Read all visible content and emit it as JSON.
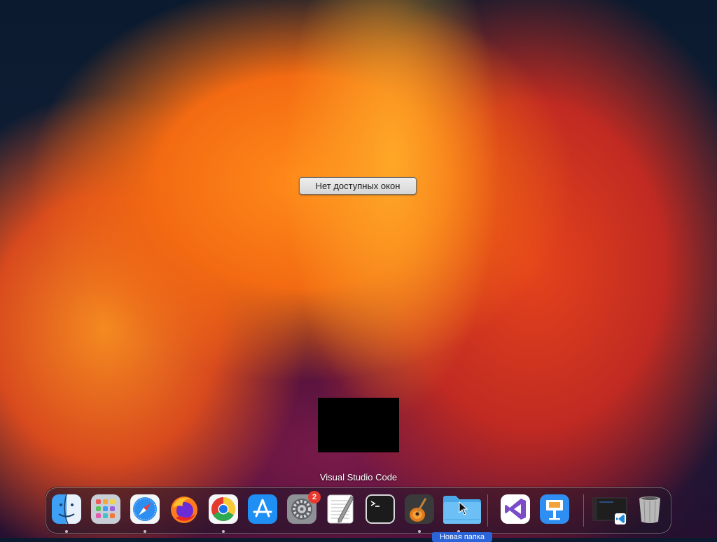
{
  "desktop": {
    "no_windows_label": "Нет доступных окон"
  },
  "dock": {
    "tooltip": "Visual Studio Code",
    "items": [
      {
        "icon": "finder-icon"
      },
      {
        "icon": "launchpad-icon"
      },
      {
        "icon": "safari-icon"
      },
      {
        "icon": "firefox-icon"
      },
      {
        "icon": "chrome-icon"
      },
      {
        "icon": "app-store-icon"
      },
      {
        "icon": "system-preferences-icon",
        "badge": "2"
      },
      {
        "icon": "textedit-icon"
      },
      {
        "icon": "terminal-icon"
      },
      {
        "icon": "garageband-icon"
      },
      {
        "icon": "folder-icon",
        "label": "Новая папка"
      },
      {
        "icon": "visual-studio-icon"
      },
      {
        "icon": "keynote-icon"
      },
      {
        "icon": "vscode-window-thumbnail-icon"
      },
      {
        "icon": "trash-icon"
      }
    ]
  },
  "colors": {
    "accent": "#2a64d8",
    "badge": "#e8392f"
  }
}
